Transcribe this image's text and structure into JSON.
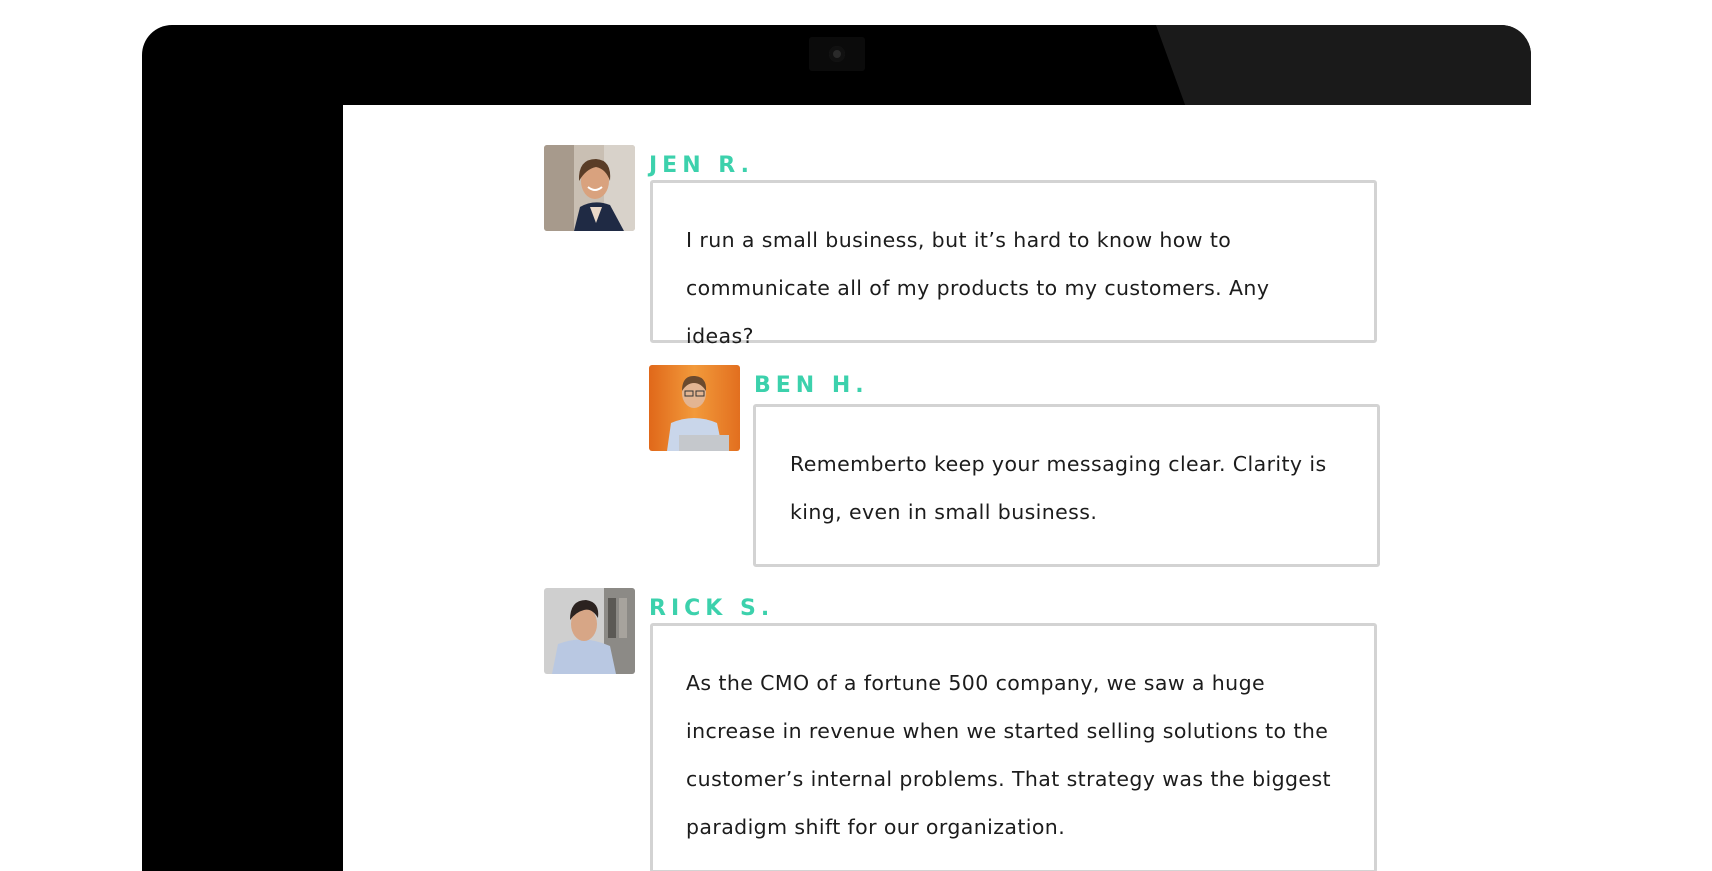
{
  "device": {
    "frame_color": "#000000",
    "screen_color": "#ffffff",
    "camera_icon": "webcam-icon"
  },
  "theme": {
    "accent": "#3cd1ac",
    "bubble_border": "#d3d3d3",
    "text": "#1c1c1c"
  },
  "comments": [
    {
      "author": "JEN R.",
      "avatar": "woman-portrait-avatar",
      "text": "I run a small business, but it’s hard to know how to communicate all of my products to my customers. Any ideas?"
    },
    {
      "author": "BEN H.",
      "avatar": "man-with-laptop-avatar",
      "text": "Rememberto keep your messaging clear. Clarity is king, even in small business."
    },
    {
      "author": "RICK S.",
      "avatar": "man-portrait-avatar",
      "text": "As the CMO of a fortune 500 company, we saw a huge increase in revenue when we started selling solutions to the customer’s internal problems. That strategy was the biggest paradigm shift for our organization."
    }
  ]
}
